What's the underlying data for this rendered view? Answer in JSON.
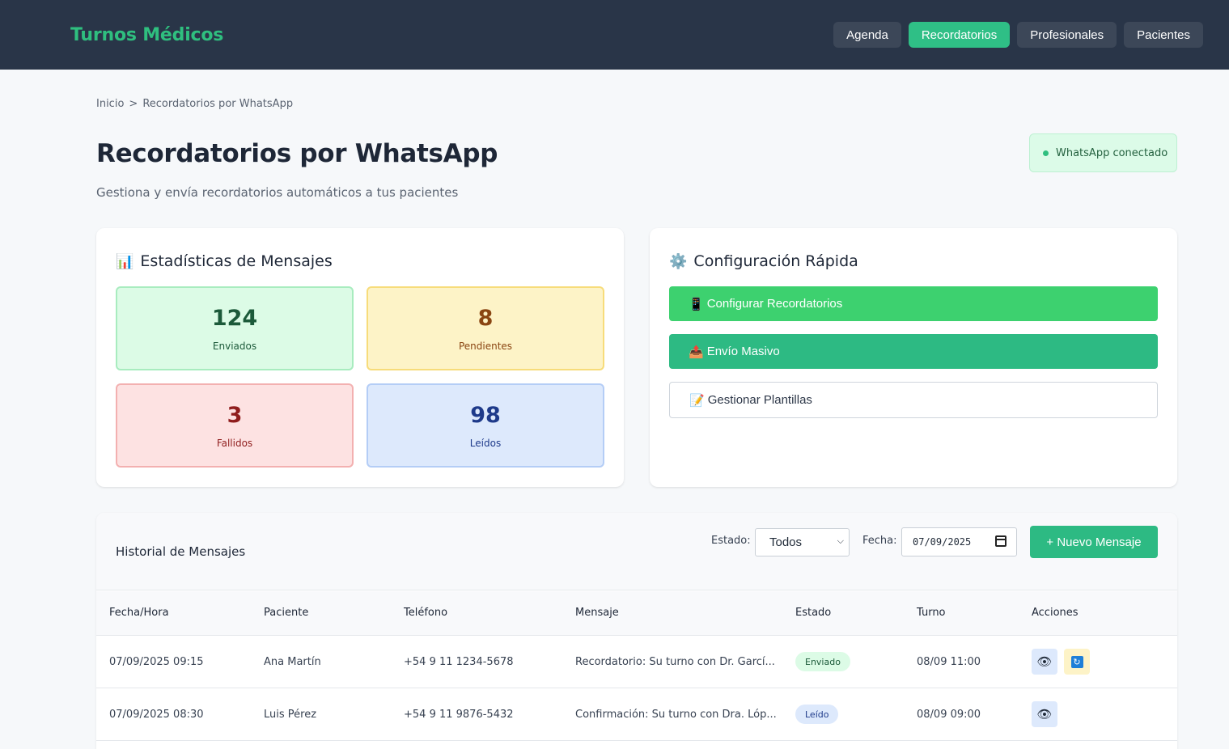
{
  "header": {
    "brand": "Turnos Médicos",
    "nav": [
      "Agenda",
      "Recordatorios",
      "Profesionales",
      "Pacientes"
    ]
  },
  "breadcrumb": {
    "home": "Inicio",
    "sep": ">",
    "current": "Recordatorios por WhatsApp"
  },
  "page": {
    "title": "Recordatorios por WhatsApp",
    "subtitle": "Gestiona y envía recordatorios automáticos a tus pacientes",
    "status": "WhatsApp conectado"
  },
  "stats": {
    "title": "Estadísticas de Mensajes",
    "icon": "📊",
    "items": [
      {
        "value": "124",
        "label": "Enviados"
      },
      {
        "value": "8",
        "label": "Pendientes"
      },
      {
        "value": "3",
        "label": "Fallidos"
      },
      {
        "value": "98",
        "label": "Leídos"
      }
    ]
  },
  "config": {
    "title": "Configuración Rápida",
    "icon": "⚙️",
    "buttons": [
      {
        "icon": "📱",
        "label": "Configurar Recordatorios"
      },
      {
        "icon": "📤",
        "label": "Envío Masivo"
      },
      {
        "icon": "📝",
        "label": "Gestionar Plantillas"
      }
    ]
  },
  "history": {
    "title": "Historial de Mensajes",
    "estado_label": "Estado:",
    "estado_value": "Todos",
    "fecha_label": "Fecha:",
    "fecha_value": "07/09/2025",
    "new_button": "+ Nuevo Mensaje",
    "columns": [
      "Fecha/Hora",
      "Paciente",
      "Teléfono",
      "Mensaje",
      "Estado",
      "Turno",
      "Acciones"
    ],
    "rows": [
      {
        "fecha": "07/09/2025 09:15",
        "paciente": "Ana Martín",
        "telefono": "+54 9 11 1234-5678",
        "mensaje": "Recordatorio: Su turno con Dr. Garcí...",
        "estado": "Enviado",
        "turno": "08/09 11:00"
      },
      {
        "fecha": "07/09/2025 08:30",
        "paciente": "Luis Pérez",
        "telefono": "+54 9 11 9876-5432",
        "mensaje": "Confirmación: Su turno con Dra. Lóp...",
        "estado": "Leído",
        "turno": "08/09 09:00"
      }
    ]
  },
  "colors": {
    "topbar": "#293548",
    "accent": "#2fbf86",
    "brand": "#2fbf7f"
  }
}
